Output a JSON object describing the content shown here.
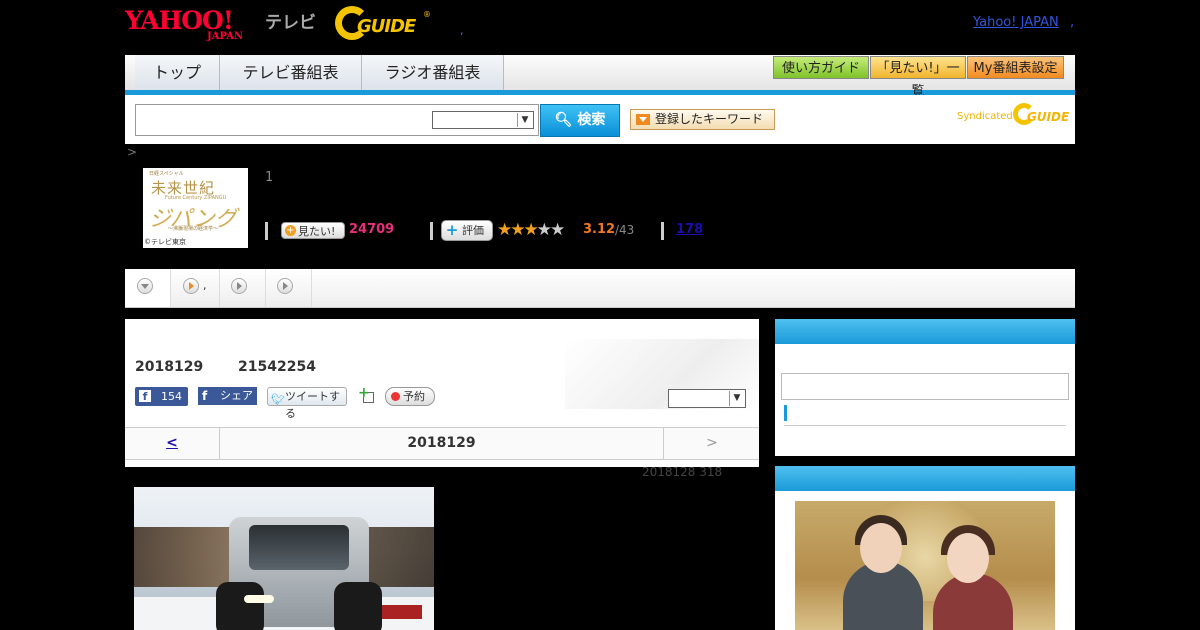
{
  "header": {
    "logo_yahoo_main": "YAHOO!",
    "logo_yahoo_sub": "JAPAN",
    "logo_tv": "テレビ",
    "logo_gguide": "GUIDE",
    "yahoo_japan_link": "Yahoo! JAPAN",
    "trailing_comma": ","
  },
  "nav": {
    "tabs": [
      "トップ",
      "テレビ番組表",
      "ラジオ番組表"
    ],
    "guide_button": "使い方ガイド",
    "mitai_list_button": "「見たい!」一覧",
    "my_schedule_button": "My番組表設定"
  },
  "search": {
    "button_label": "検索",
    "keyword_button_label": "登録したキーワード",
    "syndicated_label": "Syndicated",
    "syndicated_brand": "GUIDE"
  },
  "breadcrumb": ">",
  "program": {
    "logo_line1": "日経スペシャル",
    "logo_title": "未来世紀",
    "logo_subtitle": "Future Century ZIPANGU",
    "logo_zipangu": "ジパング",
    "logo_tagline": "〜沸騰現場の経済学〜",
    "logo_copyright": "©テレビ東京",
    "count_label": "1",
    "mitai_button": "見たい!",
    "mitai_count": "24709",
    "rating_button": "評価",
    "rating_stars": 3,
    "rating_value": "3.12",
    "rating_count": "/43",
    "review_count": "178"
  },
  "main": {
    "air_date": "2018129",
    "air_info": "21542254",
    "fb_like_count": "154",
    "fb_share_label": "シェア",
    "tweet_label": "ツイートする",
    "reserve_label": "予約",
    "date_nav": {
      "prev": "<",
      "current": "2018129",
      "next": ">"
    },
    "update_note": "2018128  318"
  },
  "colors": {
    "accent_blue": "#1a9ad9",
    "mitai_pink": "#e6307a",
    "rating_orange": "#f07820",
    "yahoo_red": "#ff0033",
    "gguide_yellow": "#f5c400"
  }
}
